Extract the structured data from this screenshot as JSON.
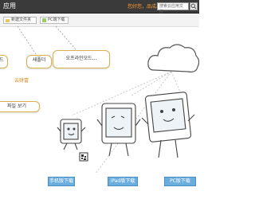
{
  "header": {
    "app_title": "应用",
    "link_text": "您好您，品成果!",
    "search_placeholder": "搜索云应用文件"
  },
  "toolbar": {
    "new_folder_label": "新建文件夹",
    "download_label": "PC端下载"
  },
  "bubbles": {
    "b1": "드",
    "b2": "새폴더",
    "b3": "오프라인모드...",
    "b4": "파일 보기"
  },
  "hint_link": "云财富",
  "downloads": {
    "phone": "手机版下载",
    "ipad": "iPad版下载",
    "pc": "PC版下载"
  },
  "colors": {
    "accent_orange": "#ff9933",
    "download_blue": "#6aaedf",
    "bubble_border": "#d8b050"
  }
}
